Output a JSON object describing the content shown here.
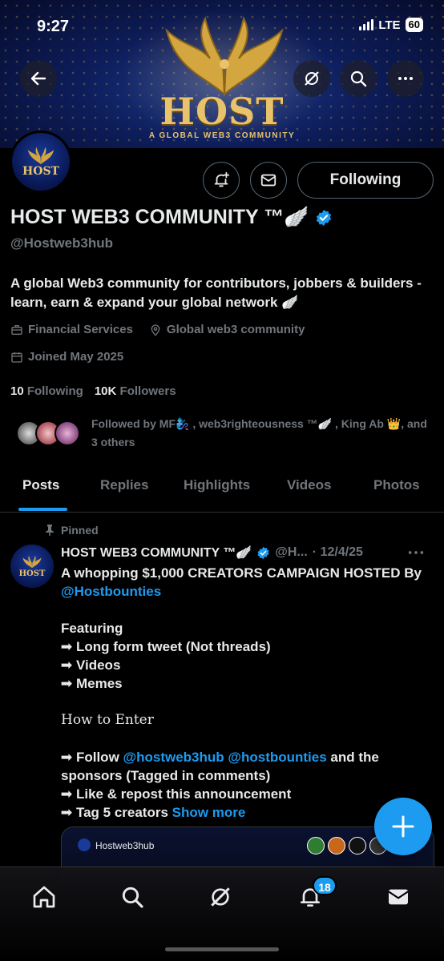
{
  "status_bar": {
    "time": "9:27",
    "network": "LTE",
    "battery": "60"
  },
  "banner": {
    "title": "HOST",
    "subtitle": "A GLOBAL WEB3 COMMUNITY"
  },
  "profile": {
    "avatar_text": "HOST",
    "name": "HOST WEB3 COMMUNITY ™🪽",
    "handle": "@Hostweb3hub",
    "bio": "A global Web3 community for contributors, jobbers & builders - learn, earn & expand your global network 🪽",
    "category": "Financial Services",
    "location": "Global web3 community",
    "joined": "Joined May 2025",
    "following_count": "10",
    "following_label": "Following",
    "followers_count": "10K",
    "followers_label": "Followers",
    "followed_by": "Followed by MF🧞‍♀️ , web3righteousness ™🪽 , King Ab 👑, and 3 others",
    "follow_button_label": "Following",
    "verified_color": "#1d9bf0"
  },
  "tabs": [
    {
      "label": "Posts"
    },
    {
      "label": "Replies"
    },
    {
      "label": "Highlights"
    },
    {
      "label": "Videos"
    },
    {
      "label": "Photos"
    }
  ],
  "pinned_post": {
    "pinned_label": "Pinned",
    "author_name": "HOST WEB3 COMMUNITY ™🪽",
    "author_handle": "@H...",
    "date": "· 12/4/25",
    "line1": "A whopping $1,000 CREATORS  CAMPAIGN HOSTED By ",
    "line1_link": "@Hostbounties",
    "featuring": "Featuring",
    "bullet1": "➟ Long form tweet (Not threads)",
    "bullet2": "➟ Videos",
    "bullet3": "➟ Memes",
    "how_to": "How to Enter",
    "step1_prefix": "➟ Follow ",
    "step1_link1": "@hostweb3hub",
    "step1_link2": "@hostbounties",
    "step1_suffix": " and the sponsors (Tagged in comments)",
    "step2": "➟ Like & repost this announcement",
    "step3": "➟ Tag 5 creators ",
    "show_more": "Show more",
    "card_label": "Hostweb3hub"
  },
  "bottom_nav": {
    "notification_count": "18"
  },
  "colors": {
    "accent": "#1d9bf0",
    "muted": "#71767b",
    "gold": "#e8c36b"
  }
}
